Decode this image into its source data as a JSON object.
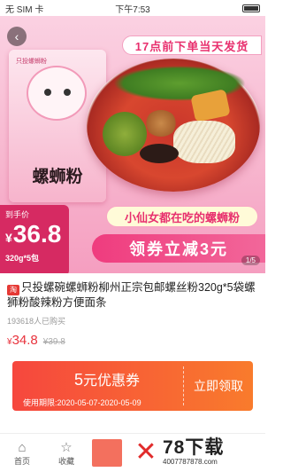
{
  "status_bar": {
    "carrier": "无 SIM 卡",
    "time": "下午7:53"
  },
  "hero": {
    "ribbon": "17点前下单当天发货",
    "package_small": "只投螺蛳粉",
    "package_brand": "螺蛳粉",
    "tagline": "小仙女都在吃的螺蛳粉",
    "coupon_banner": "领券立减3元",
    "price_label": "到手价",
    "price_currency": "¥",
    "price_value": "36.8",
    "spec": "320g*5包",
    "pager": "1/5"
  },
  "product": {
    "shop_badge": "淘",
    "title": "只投螺碗螺蛳粉柳州正宗包邮螺丝粉320g*5袋螺狮粉酸辣粉方便面条",
    "sold": "193618人已购买",
    "price_currency": "¥",
    "price_now": "34.8",
    "price_old": "¥39.8"
  },
  "coupon": {
    "amount_num": "5",
    "amount_text": "元优惠券",
    "date": "使用期限:2020-05-07-2020-05-09",
    "action": "立即领取"
  },
  "bottom": {
    "home_label": "首页",
    "fav_label": "收藏",
    "watermark_main": "78下载",
    "watermark_sub": "4007787878.com"
  },
  "colors": {
    "accent": "#e8306e",
    "price": "#e8333d",
    "coupon_start": "#f6473e",
    "coupon_end": "#f97b2c"
  }
}
